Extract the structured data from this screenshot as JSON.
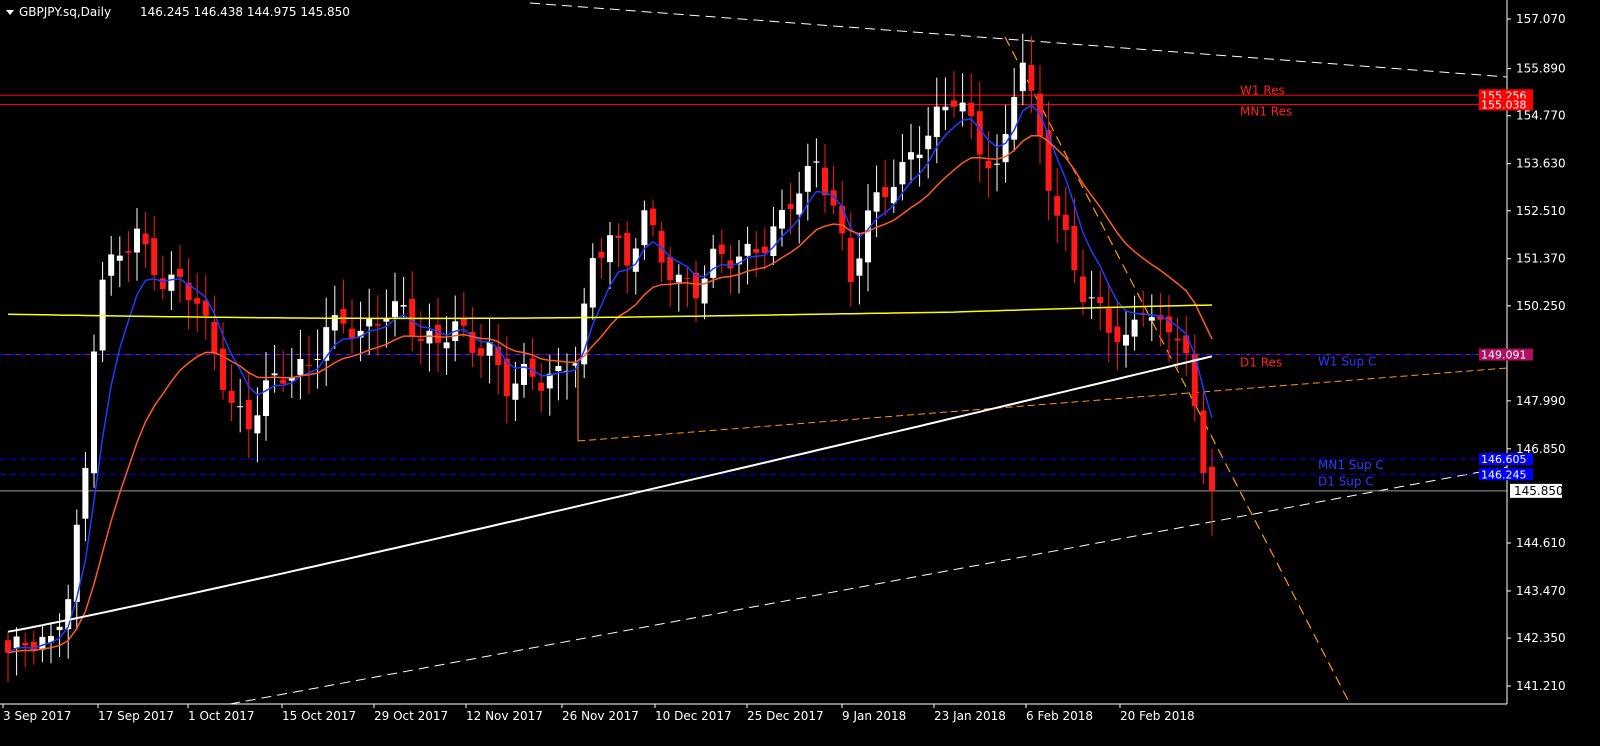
{
  "header": {
    "symbol": "GBPJPY.sq,Daily",
    "ohlc": "146.245 146.438 144.975 145.850"
  },
  "chart_data": {
    "type": "candlestick",
    "price_range": [
      140.5,
      157.6
    ],
    "price_ticks": [
      157.07,
      155.89,
      154.77,
      153.63,
      152.51,
      151.37,
      150.25,
      147.99,
      146.85,
      144.61,
      143.47,
      142.35,
      141.21
    ],
    "price_tick_labels": [
      "157.070",
      "155.890",
      "154.770",
      "153.630",
      "152.510",
      "151.370",
      "150.250",
      "147.990",
      "146.850",
      "144.610",
      "143.470",
      "142.350",
      "141.210"
    ],
    "date_ticks": [
      "3 Sep 2017",
      "17 Sep 2017",
      "1 Oct 2017",
      "15 Oct 2017",
      "29 Oct 2017",
      "12 Nov 2017",
      "26 Nov 2017",
      "10 Dec 2017",
      "25 Dec 2017",
      "9 Jan 2018",
      "23 Jan 2018",
      "6 Feb 2018",
      "20 Feb 2018"
    ],
    "current_price": 145.85,
    "current_price_label": "145.850",
    "colors": {
      "background": "#000000",
      "bull": "#ffffff",
      "bear": "#ff1a1a",
      "ema_fast": "#1c3cff",
      "ema_mid": "#ff5a1f",
      "ma_yellow": "#ffff00",
      "ma_white": "#ffffff",
      "trend_orange": "#ff9900",
      "res_red": "#ff0000",
      "sup_blue": "#0000ff",
      "d1_res_magenta": "#b01060"
    },
    "levels": [
      {
        "name": "W1 Res",
        "price": 155.256,
        "label": "155.256",
        "color": "#ff0000",
        "style": "solid"
      },
      {
        "name": "MN1 Res",
        "price": 155.038,
        "label": "155.038",
        "color": "#ff0000",
        "style": "solid"
      },
      {
        "name": "D1 Res",
        "price": 149.091,
        "label": "149.091",
        "color": "#b01060",
        "style": "solid"
      },
      {
        "name": "W1 Sup C",
        "price": 149.091,
        "label": "",
        "color": "#0000ff",
        "style": "dash"
      },
      {
        "name": "MN1 Sup C",
        "price": 146.605,
        "label": "146.605",
        "color": "#0000ff",
        "style": "dash"
      },
      {
        "name": "D1 Sup C",
        "price": 146.245,
        "label": "146.245",
        "color": "#0000ff",
        "style": "dash"
      }
    ],
    "level_labels": [
      {
        "text": "W1 Res",
        "color": "#ff2020",
        "price": 155.256,
        "position": "right-middle"
      },
      {
        "text": "MN1 Res",
        "color": "#ff2020",
        "price": 155.038,
        "position": "right-middle"
      },
      {
        "text": "D1 Res",
        "color": "#ff2020",
        "price": 149.091,
        "position": "right-middle"
      },
      {
        "text": "W1 Sup C",
        "color": "#2b3bff",
        "price": 149.091,
        "position": "right"
      },
      {
        "text": "MN1 Sup C",
        "color": "#2b3bff",
        "price": 146.605,
        "position": "right"
      },
      {
        "text": "D1 Sup C",
        "color": "#2b3bff",
        "price": 146.245,
        "position": "right"
      }
    ]
  }
}
